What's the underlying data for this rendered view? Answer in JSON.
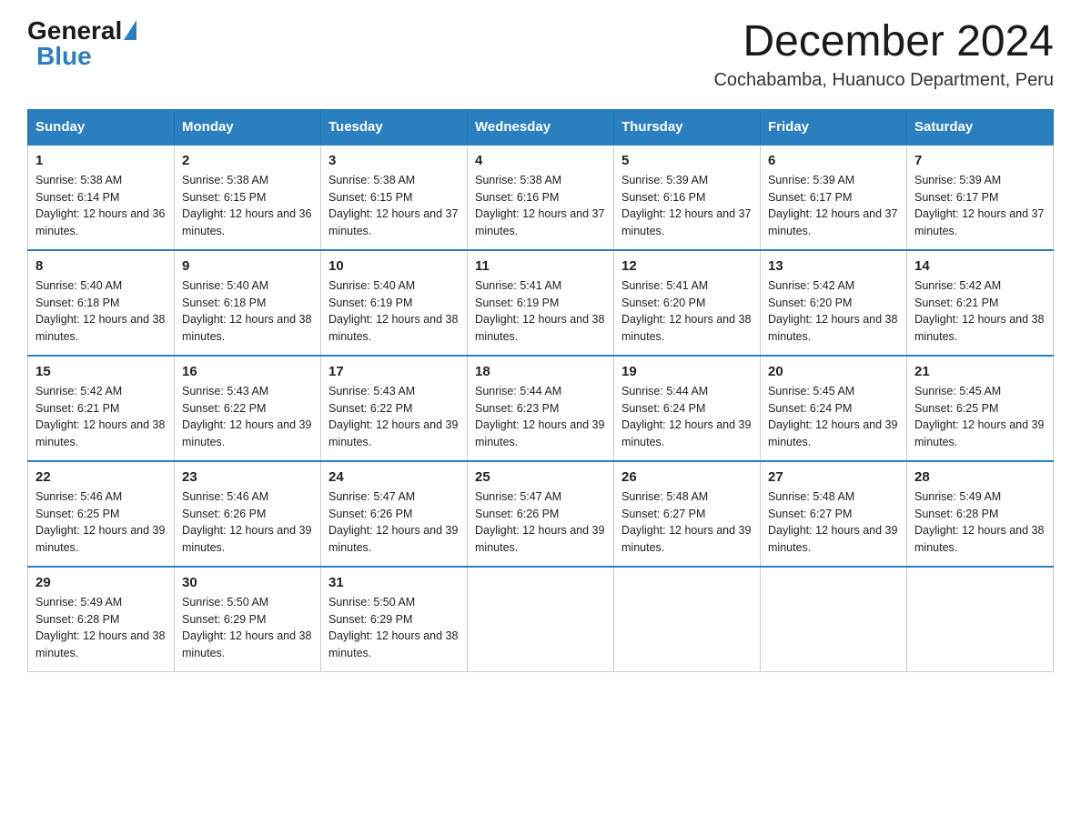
{
  "logo": {
    "general": "General",
    "blue": "Blue"
  },
  "title": "December 2024",
  "subtitle": "Cochabamba, Huanuco Department, Peru",
  "headers": [
    "Sunday",
    "Monday",
    "Tuesday",
    "Wednesday",
    "Thursday",
    "Friday",
    "Saturday"
  ],
  "weeks": [
    [
      {
        "day": "1",
        "sunrise": "5:38 AM",
        "sunset": "6:14 PM",
        "daylight": "12 hours and 36 minutes."
      },
      {
        "day": "2",
        "sunrise": "5:38 AM",
        "sunset": "6:15 PM",
        "daylight": "12 hours and 36 minutes."
      },
      {
        "day": "3",
        "sunrise": "5:38 AM",
        "sunset": "6:15 PM",
        "daylight": "12 hours and 37 minutes."
      },
      {
        "day": "4",
        "sunrise": "5:38 AM",
        "sunset": "6:16 PM",
        "daylight": "12 hours and 37 minutes."
      },
      {
        "day": "5",
        "sunrise": "5:39 AM",
        "sunset": "6:16 PM",
        "daylight": "12 hours and 37 minutes."
      },
      {
        "day": "6",
        "sunrise": "5:39 AM",
        "sunset": "6:17 PM",
        "daylight": "12 hours and 37 minutes."
      },
      {
        "day": "7",
        "sunrise": "5:39 AM",
        "sunset": "6:17 PM",
        "daylight": "12 hours and 37 minutes."
      }
    ],
    [
      {
        "day": "8",
        "sunrise": "5:40 AM",
        "sunset": "6:18 PM",
        "daylight": "12 hours and 38 minutes."
      },
      {
        "day": "9",
        "sunrise": "5:40 AM",
        "sunset": "6:18 PM",
        "daylight": "12 hours and 38 minutes."
      },
      {
        "day": "10",
        "sunrise": "5:40 AM",
        "sunset": "6:19 PM",
        "daylight": "12 hours and 38 minutes."
      },
      {
        "day": "11",
        "sunrise": "5:41 AM",
        "sunset": "6:19 PM",
        "daylight": "12 hours and 38 minutes."
      },
      {
        "day": "12",
        "sunrise": "5:41 AM",
        "sunset": "6:20 PM",
        "daylight": "12 hours and 38 minutes."
      },
      {
        "day": "13",
        "sunrise": "5:42 AM",
        "sunset": "6:20 PM",
        "daylight": "12 hours and 38 minutes."
      },
      {
        "day": "14",
        "sunrise": "5:42 AM",
        "sunset": "6:21 PM",
        "daylight": "12 hours and 38 minutes."
      }
    ],
    [
      {
        "day": "15",
        "sunrise": "5:42 AM",
        "sunset": "6:21 PM",
        "daylight": "12 hours and 38 minutes."
      },
      {
        "day": "16",
        "sunrise": "5:43 AM",
        "sunset": "6:22 PM",
        "daylight": "12 hours and 39 minutes."
      },
      {
        "day": "17",
        "sunrise": "5:43 AM",
        "sunset": "6:22 PM",
        "daylight": "12 hours and 39 minutes."
      },
      {
        "day": "18",
        "sunrise": "5:44 AM",
        "sunset": "6:23 PM",
        "daylight": "12 hours and 39 minutes."
      },
      {
        "day": "19",
        "sunrise": "5:44 AM",
        "sunset": "6:24 PM",
        "daylight": "12 hours and 39 minutes."
      },
      {
        "day": "20",
        "sunrise": "5:45 AM",
        "sunset": "6:24 PM",
        "daylight": "12 hours and 39 minutes."
      },
      {
        "day": "21",
        "sunrise": "5:45 AM",
        "sunset": "6:25 PM",
        "daylight": "12 hours and 39 minutes."
      }
    ],
    [
      {
        "day": "22",
        "sunrise": "5:46 AM",
        "sunset": "6:25 PM",
        "daylight": "12 hours and 39 minutes."
      },
      {
        "day": "23",
        "sunrise": "5:46 AM",
        "sunset": "6:26 PM",
        "daylight": "12 hours and 39 minutes."
      },
      {
        "day": "24",
        "sunrise": "5:47 AM",
        "sunset": "6:26 PM",
        "daylight": "12 hours and 39 minutes."
      },
      {
        "day": "25",
        "sunrise": "5:47 AM",
        "sunset": "6:26 PM",
        "daylight": "12 hours and 39 minutes."
      },
      {
        "day": "26",
        "sunrise": "5:48 AM",
        "sunset": "6:27 PM",
        "daylight": "12 hours and 39 minutes."
      },
      {
        "day": "27",
        "sunrise": "5:48 AM",
        "sunset": "6:27 PM",
        "daylight": "12 hours and 39 minutes."
      },
      {
        "day": "28",
        "sunrise": "5:49 AM",
        "sunset": "6:28 PM",
        "daylight": "12 hours and 38 minutes."
      }
    ],
    [
      {
        "day": "29",
        "sunrise": "5:49 AM",
        "sunset": "6:28 PM",
        "daylight": "12 hours and 38 minutes."
      },
      {
        "day": "30",
        "sunrise": "5:50 AM",
        "sunset": "6:29 PM",
        "daylight": "12 hours and 38 minutes."
      },
      {
        "day": "31",
        "sunrise": "5:50 AM",
        "sunset": "6:29 PM",
        "daylight": "12 hours and 38 minutes."
      },
      null,
      null,
      null,
      null
    ]
  ]
}
